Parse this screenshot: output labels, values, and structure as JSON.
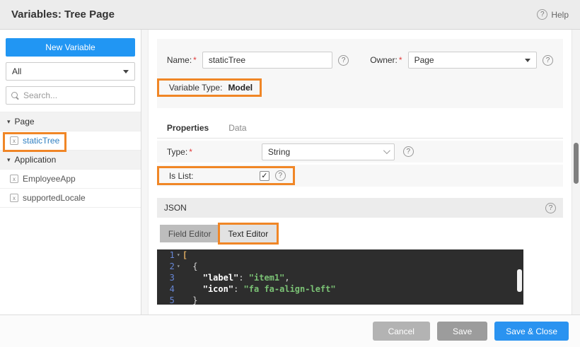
{
  "colors": {
    "accent_blue": "#2196f3",
    "annotation_orange": "#f08626",
    "editor_background": "#2d2d2d",
    "code_string_green": "#7bc275",
    "line_number_blue": "#6787d7"
  },
  "icons": {
    "help": "?",
    "caret_down": "▾",
    "check": "✓",
    "fold_open": "▾"
  },
  "header": {
    "title": "Variables: Tree Page",
    "help_label": "Help"
  },
  "sidebar": {
    "new_variable_label": "New Variable",
    "filter_value": "All",
    "search_placeholder": "Search...",
    "tree": [
      {
        "type": "group",
        "label": "Page"
      },
      {
        "type": "item",
        "label": "staticTree",
        "selected": true,
        "annotated": true
      },
      {
        "type": "group",
        "label": "Application"
      },
      {
        "type": "item",
        "label": "EmployeeApp"
      },
      {
        "type": "item",
        "label": "supportedLocale"
      }
    ]
  },
  "form": {
    "name_label": "Name:",
    "name_value": "staticTree",
    "owner_label": "Owner:",
    "owner_value": "Page",
    "variable_type_label": "Variable Type:",
    "variable_type_value": "Model"
  },
  "tabs": [
    {
      "label": "Properties",
      "active": true
    },
    {
      "label": "Data",
      "active": false
    }
  ],
  "properties": {
    "type_label": "Type:",
    "type_value": "String",
    "is_list_label": "Is List:",
    "is_list_checked": true
  },
  "json_section": {
    "title": "JSON",
    "editor_tabs": [
      {
        "label": "Field Editor",
        "active": false,
        "annotated": false
      },
      {
        "label": "Text Editor",
        "active": true,
        "annotated": true
      }
    ],
    "code": [
      {
        "n": "1",
        "fold": true,
        "tokens": [
          [
            "bracket",
            "["
          ]
        ]
      },
      {
        "n": "2",
        "fold": true,
        "tokens": [
          [
            "plain",
            "  {"
          ]
        ]
      },
      {
        "n": "3",
        "fold": false,
        "tokens": [
          [
            "plain",
            "    "
          ],
          [
            "key",
            "\"label\""
          ],
          [
            "plain",
            ": "
          ],
          [
            "str",
            "\"item1\""
          ],
          [
            "plain",
            ","
          ]
        ]
      },
      {
        "n": "4",
        "fold": false,
        "tokens": [
          [
            "plain",
            "    "
          ],
          [
            "key",
            "\"icon\""
          ],
          [
            "plain",
            ": "
          ],
          [
            "str",
            "\"fa fa-align-left\""
          ]
        ]
      },
      {
        "n": "5",
        "fold": false,
        "tokens": [
          [
            "plain",
            "  }"
          ]
        ]
      }
    ]
  },
  "footer": {
    "cancel_label": "Cancel",
    "save_label": "Save",
    "save_close_label": "Save & Close"
  }
}
